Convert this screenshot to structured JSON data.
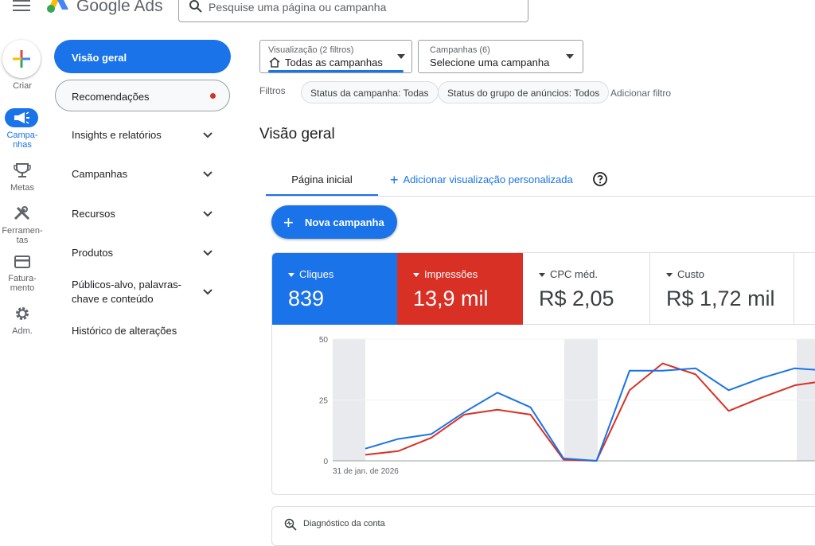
{
  "header": {
    "brand": "Google Ads",
    "search_placeholder": "Pesquise uma página ou campanha"
  },
  "rail": {
    "items": [
      {
        "label": "Criar"
      },
      {
        "label": "Campa-\nnhas"
      },
      {
        "label": "Metas"
      },
      {
        "label": "Ferramen-\ntas"
      },
      {
        "label": "Fatura-\nmento"
      },
      {
        "label": "Adm."
      }
    ]
  },
  "sidenav": {
    "active": "Visão geral",
    "recommendations": "Recomendações",
    "items": [
      {
        "label": "Insights e relatórios"
      },
      {
        "label": "Campanhas"
      },
      {
        "label": "Recursos"
      },
      {
        "label": "Produtos"
      },
      {
        "label": "Públicos-alvo, palavras-chave e conteúdo"
      },
      {
        "label": "Histórico de alterações"
      }
    ]
  },
  "view_selector": {
    "small": "Visualização (2 filtros)",
    "value": "Todas as campanhas"
  },
  "campaign_selector": {
    "small": "Campanhas (6)",
    "value": "Selecione uma campanha"
  },
  "filters": {
    "label": "Filtros",
    "chips": [
      "Status da campanha: Todas",
      "Status do grupo de anúncios: Todos"
    ],
    "add": "Adicionar filtro"
  },
  "main": {
    "title": "Visão geral",
    "tabs": [
      {
        "label": "Página inicial"
      }
    ],
    "add_view": "Adicionar visualização personalizada",
    "new_campaign": "Nova campanha"
  },
  "metrics": [
    {
      "label": "Cliques",
      "value": "839",
      "color": "#1a73e8"
    },
    {
      "label": "Impressões",
      "value": "13,9 mil",
      "color": "#d93025"
    },
    {
      "label": "CPC méd.",
      "value": "R$ 2,05"
    },
    {
      "label": "Custo",
      "value": "R$ 1,72 mil"
    }
  ],
  "chart_data": {
    "type": "line",
    "x_start_label": "31 de jan. de 2026",
    "ylim": [
      0,
      50
    ],
    "y_ticks": [
      0,
      25,
      50
    ],
    "series": [
      {
        "name": "Cliques",
        "color": "#1a73e8",
        "values": [
          5,
          9,
          11,
          20,
          28,
          22,
          1,
          0,
          37,
          37,
          38,
          29,
          34,
          38,
          37
        ]
      },
      {
        "name": "Impressões",
        "color": "#d93025",
        "values": [
          2.5,
          4,
          9.5,
          19,
          21,
          19,
          0.5,
          0,
          29,
          40,
          35.5,
          20.5,
          26,
          31,
          33
        ]
      }
    ]
  },
  "diagnostics": {
    "label": "Diagnóstico da conta"
  },
  "colors": {
    "accent": "#1a73e8",
    "red": "#d93025"
  }
}
